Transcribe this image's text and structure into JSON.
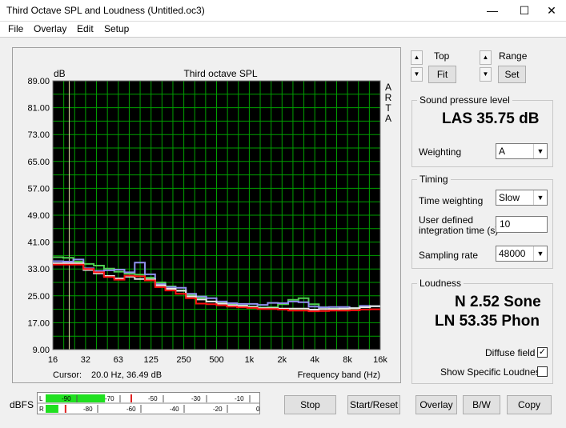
{
  "window": {
    "title": "Third Octave SPL and Loudness (Untitled.oc3)",
    "minimize": "—",
    "maximize": "☐",
    "close": "✕"
  },
  "menu": [
    "File",
    "Overlay",
    "Edit",
    "Setup"
  ],
  "plot": {
    "title": "Third octave SPL",
    "ylabel_unit": "dB",
    "side_text": [
      "A",
      "R",
      "T",
      "A"
    ],
    "cursor_label": "Cursor:",
    "cursor_value": "20.0 Hz, 36.49 dB",
    "xlabel": "Frequency band (Hz)"
  },
  "chart_data": {
    "type": "line",
    "y_ticks": [
      "89.00",
      "81.00",
      "73.00",
      "65.00",
      "57.00",
      "49.00",
      "41.00",
      "33.00",
      "25.00",
      "17.00",
      "9.00"
    ],
    "x_ticks": [
      "16",
      "32",
      "63",
      "125",
      "250",
      "500",
      "1k",
      "2k",
      "4k",
      "8k",
      "16k"
    ],
    "ylim": [
      9,
      89
    ],
    "grid": true,
    "background": "#000000",
    "grid_color": "#00a000",
    "bands": [
      "16",
      "20",
      "25",
      "31.5",
      "40",
      "50",
      "63",
      "80",
      "100",
      "125",
      "160",
      "200",
      "250",
      "315",
      "400",
      "500",
      "630",
      "800",
      "1k",
      "1.25k",
      "1.6k",
      "2k",
      "2.5k",
      "3.15k",
      "4k",
      "5k",
      "6.3k",
      "8k",
      "10k",
      "12.5k",
      "16k",
      "20k"
    ],
    "series": [
      {
        "color": "#50d050",
        "values": [
          36.5,
          36.3,
          35.2,
          34.5,
          34.0,
          33.1,
          32.2,
          31.6,
          31.3,
          30.4,
          29.0,
          27.8,
          26.6,
          25.2,
          24.4,
          23.3,
          22.8,
          22.5,
          22.1,
          21.8,
          21.5,
          21.6,
          22.5,
          23.8,
          24.3,
          22.5,
          21.6,
          21.2,
          21.0,
          21.3,
          21.7,
          21.9
        ]
      },
      {
        "color": "#9090f0",
        "values": [
          35.3,
          35.2,
          35.8,
          33.2,
          32.4,
          32.6,
          32.8,
          32.0,
          34.9,
          31.4,
          28.5,
          27.6,
          27.4,
          25.6,
          24.8,
          24.3,
          23.3,
          22.8,
          22.6,
          22.6,
          22.3,
          22.9,
          22.8,
          23.3,
          23.1,
          21.8,
          21.6,
          21.7,
          21.7,
          21.3,
          22.0,
          21.9
        ]
      },
      {
        "color": "#e8e8e8",
        "values": [
          34.7,
          34.7,
          34.7,
          32.7,
          31.7,
          30.9,
          30.2,
          30.7,
          30.0,
          29.9,
          28.1,
          27.1,
          26.5,
          24.8,
          23.9,
          23.3,
          22.7,
          22.2,
          22.0,
          21.7,
          21.3,
          21.3,
          21.2,
          21.2,
          21.2,
          20.9,
          21.1,
          21.1,
          21.2,
          21.3,
          21.6,
          21.9
        ]
      },
      {
        "color": "#ff1010",
        "values": [
          34.3,
          34.3,
          34.3,
          33.0,
          32.0,
          30.6,
          29.8,
          31.0,
          30.8,
          29.6,
          27.6,
          26.6,
          25.6,
          24.3,
          22.7,
          22.5,
          22.2,
          21.8,
          21.6,
          21.4,
          21.1,
          21.1,
          20.9,
          20.6,
          20.6,
          20.4,
          20.5,
          20.6,
          20.6,
          20.7,
          20.9,
          21.0
        ]
      }
    ]
  },
  "top": {
    "label": "Top",
    "fit": "Fit"
  },
  "range": {
    "label": "Range",
    "set": "Set"
  },
  "spl": {
    "title": "Sound pressure level",
    "value": "LAS 35.75 dB",
    "weighting_label": "Weighting",
    "weighting_value": "A"
  },
  "timing": {
    "title": "Timing",
    "time_weighting_label": "Time weighting",
    "time_weighting_value": "Slow",
    "integration_label_1": "User defined",
    "integration_label_2": "integration time (s)",
    "integration_value": "10",
    "sampling_label": "Sampling rate",
    "sampling_value": "48000"
  },
  "loudness": {
    "title": "Loudness",
    "sone": "N 2.52 Sone",
    "phon": "LN 53.35 Phon",
    "diffuse_label": "Diffuse field",
    "specific_label": "Show Specific Loudness"
  },
  "meter": {
    "label": "dBFS",
    "left_channel": "L",
    "right_channel": "R",
    "top_ticks": [
      "-90",
      "-70",
      "-50",
      "-30",
      "-10"
    ],
    "bottom_ticks": [
      "-80",
      "-60",
      "-40",
      "-20",
      "0"
    ],
    "left_level": 0.28,
    "right_level": 0.06
  },
  "buttons": {
    "stop": "Stop",
    "start_reset": "Start/Reset",
    "overlay": "Overlay",
    "bw": "B/W",
    "copy": "Copy"
  }
}
